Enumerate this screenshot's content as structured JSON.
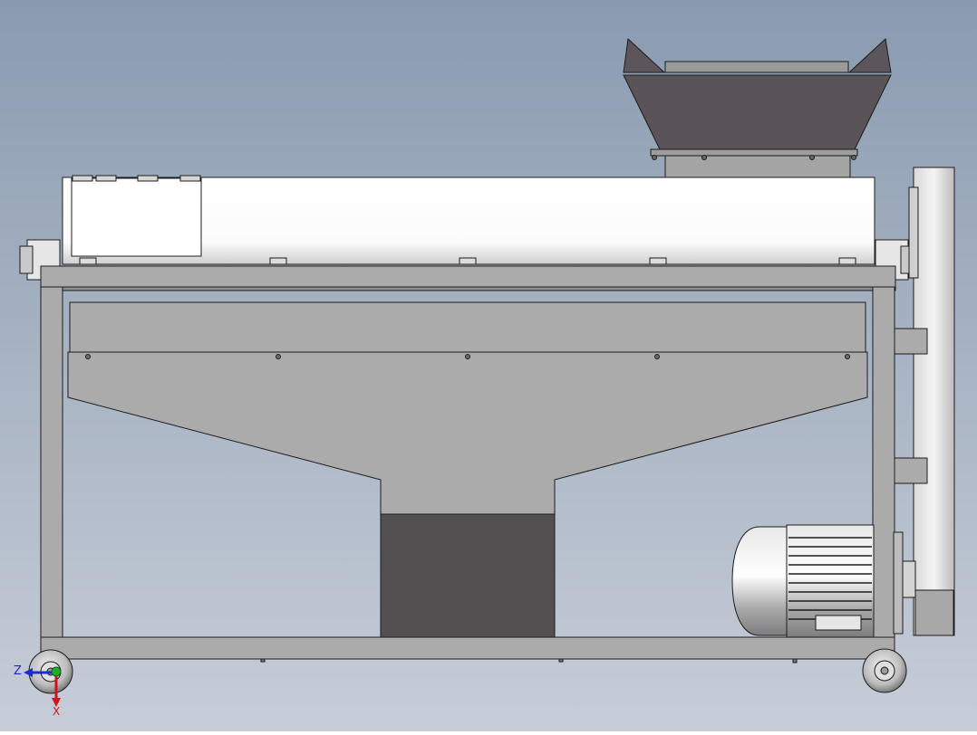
{
  "viewport": {
    "background_top": "#8a9bb0",
    "background_bottom": "#c7cdd8"
  },
  "triad": {
    "z_label": "Z",
    "x_label": "X",
    "z_color": "#1a2cd6",
    "x_color": "#d41414",
    "origin_color": "#1fae2a"
  },
  "model": {
    "frame_color": "#ababab",
    "drum_color": "#ffffff",
    "hopper_color": "#5a5459",
    "outlet_color": "#535052",
    "motor_color": "#c8c8c8",
    "edge_color": "#1c1c1c"
  }
}
